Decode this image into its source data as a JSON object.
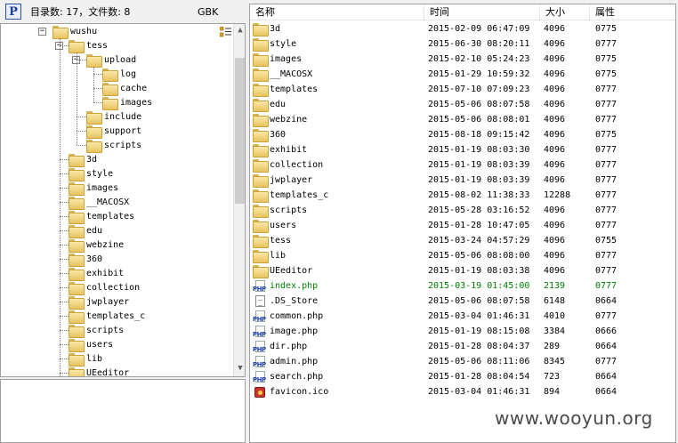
{
  "top": {
    "status": "目录数: 17，文件数: 8",
    "encoding": "GBK"
  },
  "tree": {
    "root": {
      "label": "wushu",
      "expanded": true
    },
    "nodes": [
      {
        "label": "tess",
        "depth": 1,
        "expanded": true
      },
      {
        "label": "upload",
        "depth": 2,
        "expanded": true
      },
      {
        "label": "log",
        "depth": 3
      },
      {
        "label": "cache",
        "depth": 3
      },
      {
        "label": "images",
        "depth": 3
      },
      {
        "label": "include",
        "depth": 2
      },
      {
        "label": "support",
        "depth": 2
      },
      {
        "label": "scripts",
        "depth": 2
      },
      {
        "label": "3d",
        "depth": 1
      },
      {
        "label": "style",
        "depth": 1
      },
      {
        "label": "images",
        "depth": 1
      },
      {
        "label": "__MACOSX",
        "depth": 1
      },
      {
        "label": "templates",
        "depth": 1
      },
      {
        "label": "edu",
        "depth": 1
      },
      {
        "label": "webzine",
        "depth": 1
      },
      {
        "label": "360",
        "depth": 1
      },
      {
        "label": "exhibit",
        "depth": 1
      },
      {
        "label": "collection",
        "depth": 1
      },
      {
        "label": "jwplayer",
        "depth": 1
      },
      {
        "label": "templates_c",
        "depth": 1
      },
      {
        "label": "scripts",
        "depth": 1
      },
      {
        "label": "users",
        "depth": 1
      },
      {
        "label": "lib",
        "depth": 1
      },
      {
        "label": "UEeditor",
        "depth": 1
      }
    ]
  },
  "list": {
    "headers": {
      "name": "名称",
      "time": "时间",
      "size": "大小",
      "attr": "属性"
    },
    "rows": [
      {
        "name": "3d",
        "time": "2015-02-09 06:47:09",
        "size": "4096",
        "attr": "0775",
        "type": "folder"
      },
      {
        "name": "style",
        "time": "2015-06-30 08:20:11",
        "size": "4096",
        "attr": "0777",
        "type": "folder"
      },
      {
        "name": "images",
        "time": "2015-02-10 05:24:23",
        "size": "4096",
        "attr": "0775",
        "type": "folder"
      },
      {
        "name": "__MACOSX",
        "time": "2015-01-29 10:59:32",
        "size": "4096",
        "attr": "0775",
        "type": "folder"
      },
      {
        "name": "templates",
        "time": "2015-07-10 07:09:23",
        "size": "4096",
        "attr": "0777",
        "type": "folder"
      },
      {
        "name": "edu",
        "time": "2015-05-06 08:07:58",
        "size": "4096",
        "attr": "0777",
        "type": "folder"
      },
      {
        "name": "webzine",
        "time": "2015-05-06 08:08:01",
        "size": "4096",
        "attr": "0777",
        "type": "folder"
      },
      {
        "name": "360",
        "time": "2015-08-18 09:15:42",
        "size": "4096",
        "attr": "0775",
        "type": "folder"
      },
      {
        "name": "exhibit",
        "time": "2015-01-19 08:03:30",
        "size": "4096",
        "attr": "0777",
        "type": "folder"
      },
      {
        "name": "collection",
        "time": "2015-01-19 08:03:39",
        "size": "4096",
        "attr": "0777",
        "type": "folder"
      },
      {
        "name": "jwplayer",
        "time": "2015-01-19 08:03:39",
        "size": "4096",
        "attr": "0777",
        "type": "folder"
      },
      {
        "name": "templates_c",
        "time": "2015-08-02 11:38:33",
        "size": "12288",
        "attr": "0777",
        "type": "folder"
      },
      {
        "name": "scripts",
        "time": "2015-05-28 03:16:52",
        "size": "4096",
        "attr": "0777",
        "type": "folder"
      },
      {
        "name": "users",
        "time": "2015-01-28 10:47:05",
        "size": "4096",
        "attr": "0777",
        "type": "folder"
      },
      {
        "name": "tess",
        "time": "2015-03-24 04:57:29",
        "size": "4096",
        "attr": "0755",
        "type": "folder"
      },
      {
        "name": "lib",
        "time": "2015-05-06 08:08:00",
        "size": "4096",
        "attr": "0777",
        "type": "folder"
      },
      {
        "name": "UEeditor",
        "time": "2015-01-19 08:03:38",
        "size": "4096",
        "attr": "0777",
        "type": "folder"
      },
      {
        "name": "index.php",
        "time": "2015-03-19 01:45:00",
        "size": "2139",
        "attr": "0777",
        "type": "php",
        "highlight": true
      },
      {
        "name": ".DS_Store",
        "time": "2015-05-06 08:07:58",
        "size": "6148",
        "attr": "0664",
        "type": "doc"
      },
      {
        "name": "common.php",
        "time": "2015-03-04 01:46:31",
        "size": "4010",
        "attr": "0777",
        "type": "php"
      },
      {
        "name": "image.php",
        "time": "2015-01-19 08:15:08",
        "size": "3384",
        "attr": "0666",
        "type": "php"
      },
      {
        "name": "dir.php",
        "time": "2015-01-28 08:04:37",
        "size": "289",
        "attr": "0664",
        "type": "php"
      },
      {
        "name": "admin.php",
        "time": "2015-05-06 08:11:06",
        "size": "8345",
        "attr": "0777",
        "type": "php"
      },
      {
        "name": "search.php",
        "time": "2015-01-28 08:04:54",
        "size": "723",
        "attr": "0664",
        "type": "php"
      },
      {
        "name": "favicon.ico",
        "time": "2015-03-04 01:46:31",
        "size": "894",
        "attr": "0664",
        "type": "ico"
      }
    ],
    "highlight_color": "#008000",
    "php_tag": "PHP"
  },
  "watermark": "www.wooyun.org"
}
